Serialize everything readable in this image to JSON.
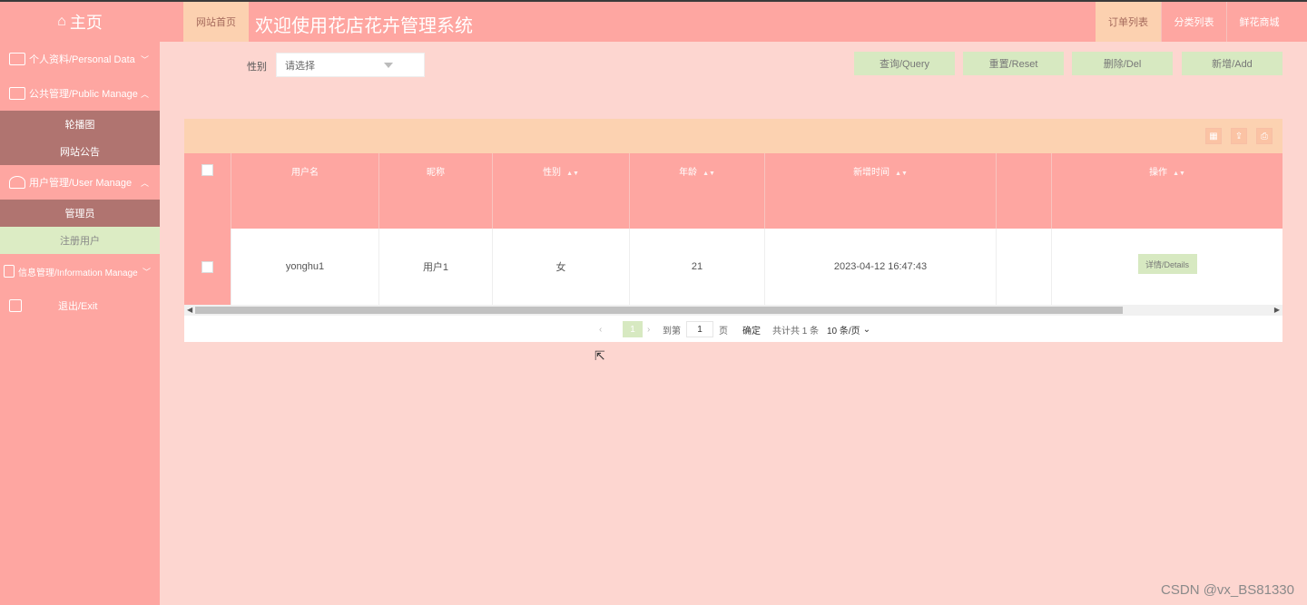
{
  "sidebar": {
    "home": "主页",
    "items": [
      {
        "label": "个人资料/Personal Data",
        "icon": "id-card-icon",
        "chevron": "﹀"
      },
      {
        "label": "公共管理/Public Manage",
        "icon": "monitor-icon",
        "chevron": "︿"
      },
      {
        "label": "轮播图",
        "sub": true
      },
      {
        "label": "网站公告",
        "sub": true
      },
      {
        "label": "用户管理/User Manage",
        "icon": "user-icon",
        "chevron": "︿"
      },
      {
        "label": "管理员",
        "sub": true
      },
      {
        "label": "注册用户",
        "sub": true,
        "active": true
      },
      {
        "label": "信息管理/Information Manage",
        "icon": "info-icon",
        "chevron": "﹀"
      },
      {
        "label": "退出/Exit",
        "icon": "exit-icon"
      }
    ]
  },
  "header": {
    "home_link": "网站首页",
    "title": "欢迎使用花店花卉管理系统",
    "nav": [
      "订单列表",
      "分类列表",
      "鲜花商城"
    ]
  },
  "search": {
    "gender_label": "性别",
    "gender_value": "请选择",
    "buttons": [
      "查询/Query",
      "重置/Reset",
      "删除/Del",
      "新增/Add"
    ]
  },
  "table": {
    "columns": [
      "用户名",
      "昵称",
      "性别",
      "年龄",
      "新增时间",
      "",
      "操作"
    ],
    "rows": [
      {
        "username": "yonghu1",
        "nickname": "用户1",
        "gender": "女",
        "age": "21",
        "created": "2023-04-12 16:47:43",
        "extra": "",
        "action": "详情/Details"
      }
    ]
  },
  "pager": {
    "current": "1",
    "goto_label": "到第",
    "page_input": "1",
    "page_unit": "页",
    "confirm": "确定",
    "total": "共计共 1 条",
    "page_size": "10 条/页"
  },
  "watermark": "CSDN @vx_BS81330",
  "colors": {
    "primary": "#fea6a1",
    "background": "#fdd6d0",
    "button": "#d7e9c1",
    "header_light": "#fcd1b0",
    "submenu": "#b07470"
  }
}
